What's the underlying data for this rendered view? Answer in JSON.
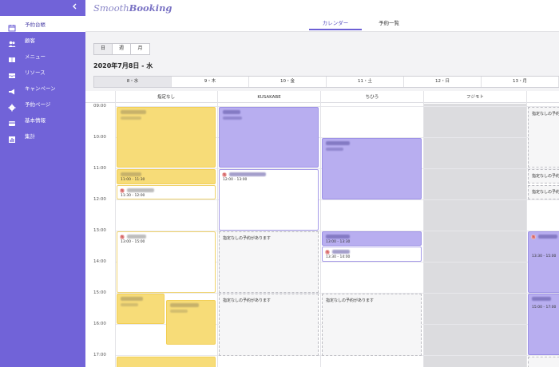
{
  "sidebar": {
    "collapse_icon": "chevron-left-icon",
    "items": [
      {
        "label": "予約台帳",
        "icon": "calendar-icon",
        "active": true
      },
      {
        "label": "顧客",
        "icon": "users-icon"
      },
      {
        "label": "メニュー",
        "icon": "book-icon"
      },
      {
        "label": "リソース",
        "icon": "inbox-icon"
      },
      {
        "label": "キャンペーン",
        "icon": "megaphone-icon"
      },
      {
        "label": "予約ページ",
        "icon": "gear-icon"
      },
      {
        "label": "基本情報",
        "icon": "card-icon"
      },
      {
        "label": "集計",
        "icon": "chart-icon"
      }
    ]
  },
  "header": {
    "logo_light": "Smooth",
    "logo_bold": "Booking",
    "tabs": [
      {
        "label": "カレンダー",
        "active": true
      },
      {
        "label": "予約一覧"
      }
    ]
  },
  "toolbar": {
    "views": [
      "日",
      "週",
      "月"
    ],
    "date_heading": "2020年7月8日 - 水"
  },
  "days": [
    "8・水",
    "9・木",
    "10・金",
    "11・土",
    "12・日",
    "13・月"
  ],
  "calendar": {
    "columns": [
      "指定なし",
      "KUSAKABE",
      "ちひろ",
      "フジモト"
    ],
    "hours": [
      "09:00",
      "10:00",
      "11:00",
      "12:00",
      "13:00",
      "14:00",
      "15:00",
      "16:00",
      "17:00"
    ],
    "empty_note": "指定なしの予約があります",
    "badge": "指",
    "times": {
      "a": "11:00 - 11:30",
      "b": "11:30 - 12:00",
      "c": "12:00 - 13:00",
      "d": "13:00 - 15:00",
      "e": "13:00 - 13:30",
      "f": "13:30 - 14:00",
      "g": "13:30 - 15:00",
      "h": "15:00 - 17:00"
    }
  },
  "colors": {
    "sidebar": "#7163d8",
    "yellow_event": "#f7dc78",
    "purple_event": "#b8aef0",
    "accent": "#6c5fd5"
  }
}
